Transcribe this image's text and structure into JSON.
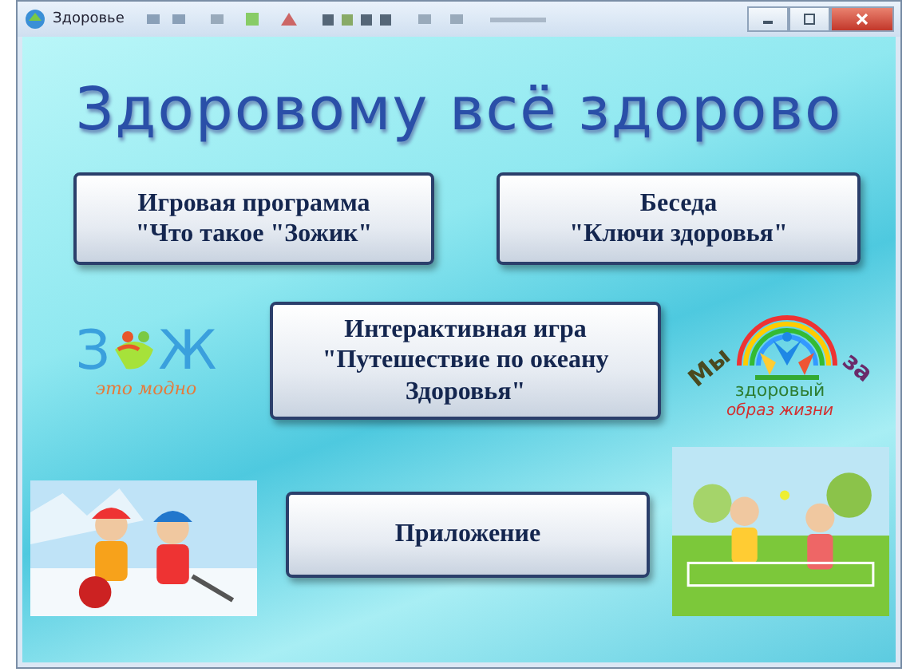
{
  "window": {
    "title": "Здоровье"
  },
  "slide": {
    "title": "Здоровому всё здорово",
    "buttons": [
      {
        "lines": [
          "Игровая программа",
          "\"Что такое \"Зожик\""
        ]
      },
      {
        "lines": [
          "Беседа",
          "\"Ключи здоровья\""
        ]
      },
      {
        "lines": [
          "Интерактивная игра",
          "\"Путешествие по океану",
          "Здоровья\""
        ]
      },
      {
        "lines": [
          "Приложение"
        ]
      }
    ],
    "logo_left": {
      "letters": [
        "З",
        "Ж"
      ],
      "caption": "это модно"
    },
    "logo_right": {
      "arc_words": [
        "Мы",
        "за"
      ],
      "lines": [
        "здоровый",
        "образ жизни"
      ]
    }
  }
}
